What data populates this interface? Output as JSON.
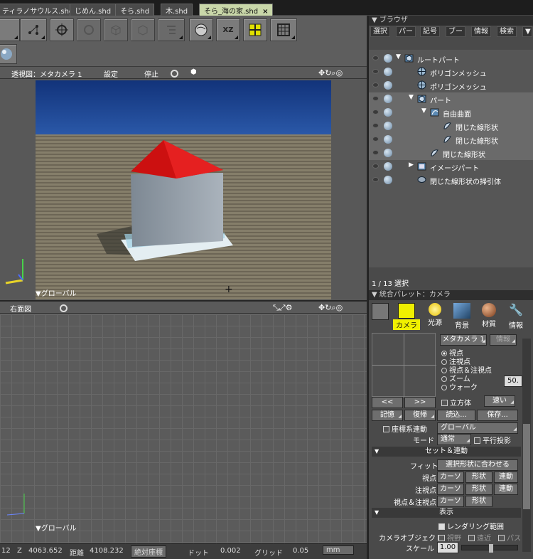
{
  "tabs": [
    {
      "label": "ティラノサウルス.shd"
    },
    {
      "label": "じめん.shd"
    },
    {
      "label": "そら.shd"
    },
    {
      "label": "木.shd"
    },
    {
      "label": "そら_海の家.shd",
      "close": "×"
    }
  ],
  "perspective_view": {
    "title": "透視図：メタカメラ 1",
    "settings": "設定",
    "stop": "停止",
    "coord_label": "▼グローバル"
  },
  "front_view": {
    "title": "右面図",
    "coord_label": "▼グローバル"
  },
  "status": {
    "x_tail": "12",
    "z_label": "Z",
    "z_value": "4063.652",
    "distance_label": "距離",
    "distance_value": "4108.232",
    "coord_mode": "絶対座標",
    "dot_label": "ドット",
    "dot_value": "0.002",
    "grid_label": "グリッド",
    "grid_value": "0.05",
    "unit": "mm"
  },
  "browser": {
    "title": "ブラウザ",
    "menus": [
      "選択",
      "パー",
      "記号",
      "ブー",
      "情報",
      "検索"
    ],
    "tree": [
      {
        "label": "ルートパート",
        "indent": 0,
        "arrow": "▼",
        "icon": "part-icon",
        "sel": false
      },
      {
        "label": "ポリゴンメッシュ",
        "indent": 1,
        "arrow": "",
        "icon": "polygon-mesh-icon",
        "sel": false
      },
      {
        "label": "ポリゴンメッシュ",
        "indent": 1,
        "arrow": "",
        "icon": "polygon-mesh-icon",
        "sel": false
      },
      {
        "label": "パート",
        "indent": 1,
        "arrow": "▼",
        "icon": "part-icon",
        "sel": true
      },
      {
        "label": "自由曲面",
        "indent": 2,
        "arrow": "▼",
        "icon": "free-surface-icon",
        "sel": true
      },
      {
        "label": "閉じた線形状",
        "indent": 3,
        "arrow": "",
        "icon": "line-shape-icon",
        "sel": true
      },
      {
        "label": "閉じた線形状",
        "indent": 3,
        "arrow": "",
        "icon": "line-shape-icon",
        "sel": true
      },
      {
        "label": "閉じた線形状",
        "indent": 2,
        "arrow": "",
        "icon": "line-shape-icon",
        "sel": true
      },
      {
        "label": "イメージパート",
        "indent": 1,
        "arrow": "▶",
        "icon": "image-part-icon",
        "sel": false
      },
      {
        "label": "閉じた線形状の掃引体",
        "indent": 1,
        "arrow": "",
        "icon": "sweep-icon",
        "sel": false
      }
    ],
    "selection_count": "1 / 13 選択"
  },
  "palette": {
    "title": "統合パレット：カメラ",
    "tabs": [
      {
        "label": "カメラ",
        "icon": "camera-icon",
        "active": true
      },
      {
        "label": "光源",
        "icon": "light-icon",
        "active": false
      },
      {
        "label": "背景",
        "icon": "background-icon",
        "active": false
      },
      {
        "label": "材質",
        "icon": "material-icon",
        "active": false
      },
      {
        "label": "情報",
        "icon": "wrench-icon",
        "active": false
      }
    ],
    "camera_select": "メタカメラ 1",
    "info_btn": "情報",
    "radios": [
      "視点",
      "注視点",
      "視点＆注視点",
      "ズーム",
      "ウォーク"
    ],
    "zoom_value": "50.",
    "prev": "<<",
    "next": ">>",
    "cube_label": "立方体",
    "speed": "速い",
    "memory": "記憶",
    "restore": "復帰",
    "load": "読込...",
    "save": "保存...",
    "coord_link_label": "座標系連動",
    "coord_value": "グローバル",
    "mode_label": "モード",
    "mode_value": "通常",
    "parallel": "平行投影",
    "section_set": "セット＆連動",
    "fit_label": "フィット",
    "fit_button": "選択形状に合わせる",
    "rows": [
      {
        "label": "視点",
        "b1": "カーソ",
        "b2": "形状",
        "b3": "連動"
      },
      {
        "label": "注視点",
        "b1": "カーソ",
        "b2": "形状",
        "b3": "連動"
      },
      {
        "label": "視点＆注視点",
        "b1": "カーソ",
        "b2": "形状",
        "b3": ""
      }
    ],
    "section_display": "表示",
    "render_range": "レンダリング範囲",
    "camera_object_label": "カメラオブジェクト",
    "cam_opts": [
      "視野",
      "遠近",
      "パス"
    ],
    "scale_label": "スケール",
    "scale_value": "1.00"
  }
}
